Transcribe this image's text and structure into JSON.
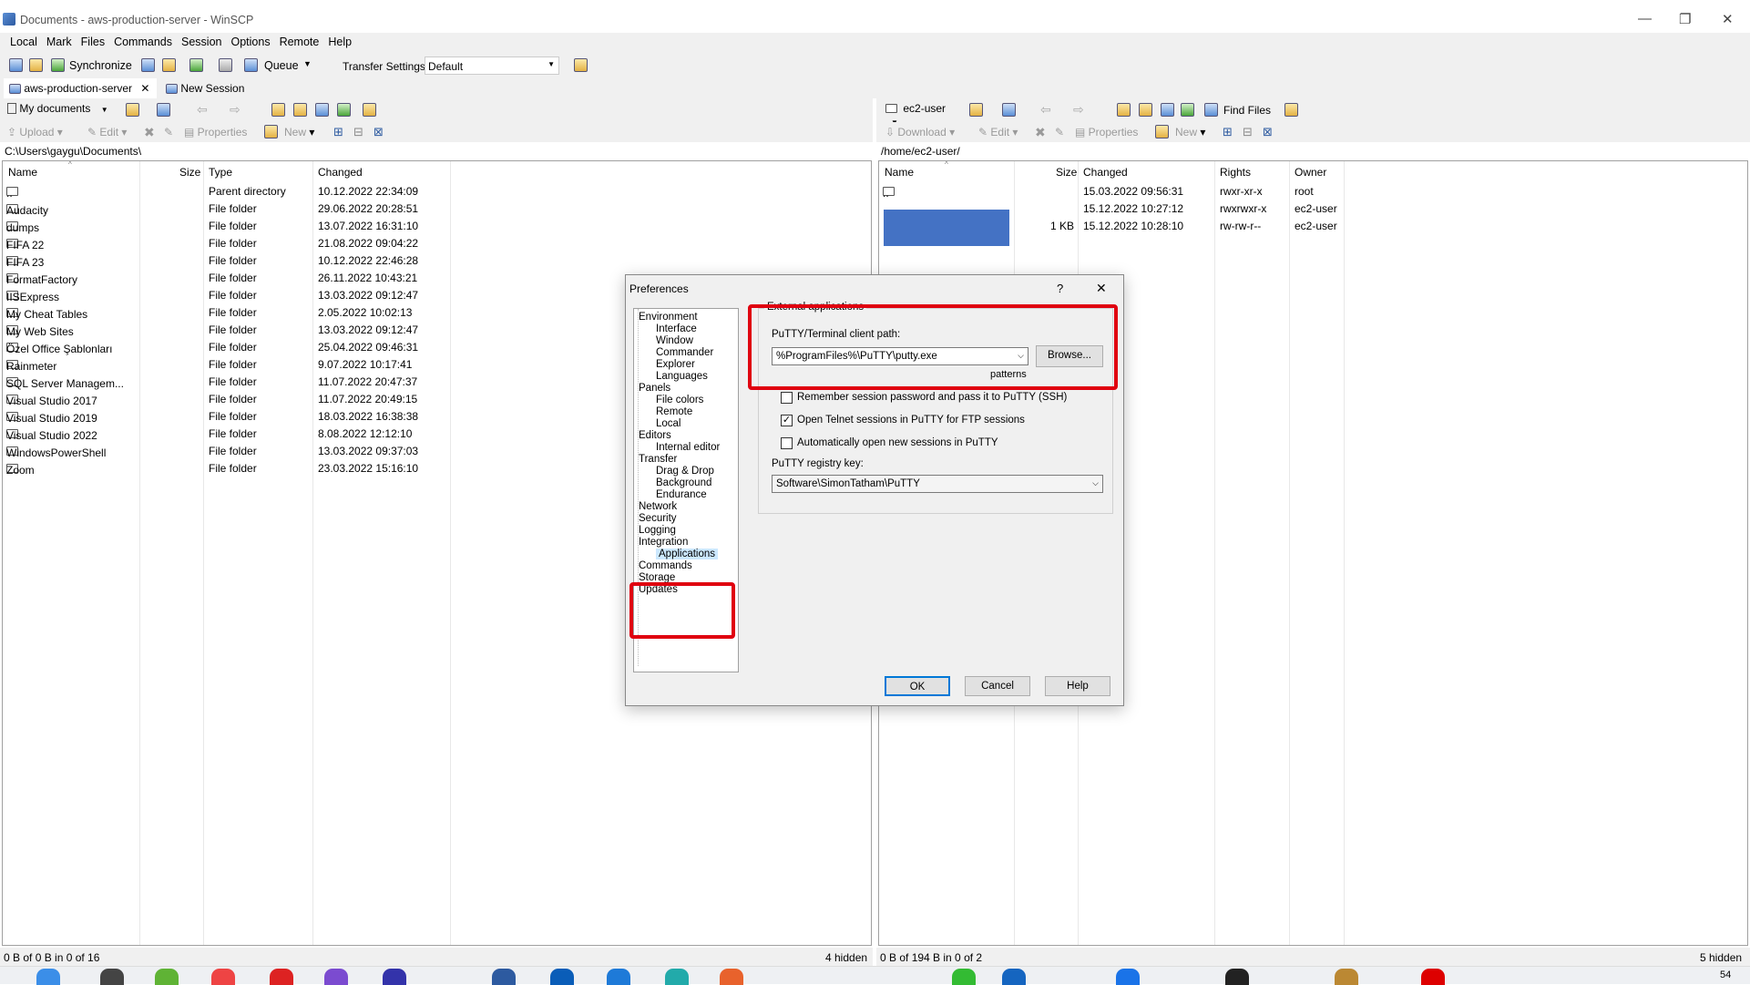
{
  "window": {
    "title": "Documents - aws-production-server - WinSCP"
  },
  "menu": [
    "Local",
    "Mark",
    "Files",
    "Commands",
    "Session",
    "Options",
    "Remote",
    "Help"
  ],
  "toolbar": {
    "synchronize": "Synchronize",
    "queue": "Queue",
    "transfer_settings_label": "Transfer Settings",
    "transfer_settings_value": "Default"
  },
  "tabs": {
    "session": "aws-production-server",
    "new_session": "New Session"
  },
  "local": {
    "location": "My documents",
    "commands": {
      "upload": "Upload",
      "edit": "Edit",
      "properties": "Properties",
      "new": "New"
    },
    "path": "C:\\Users\\gaygu\\Documents\\",
    "columns": [
      "Name",
      "Size",
      "Type",
      "Changed"
    ],
    "rows": [
      {
        "name": "..",
        "size": "",
        "type": "Parent directory",
        "changed": "10.12.2022  22:34:09"
      },
      {
        "name": "Audacity",
        "size": "",
        "type": "File folder",
        "changed": "29.06.2022  20:28:51"
      },
      {
        "name": "dumps",
        "size": "",
        "type": "File folder",
        "changed": "13.07.2022  16:31:10"
      },
      {
        "name": "FIFA 22",
        "size": "",
        "type": "File folder",
        "changed": "21.08.2022  09:04:22"
      },
      {
        "name": "FIFA 23",
        "size": "",
        "type": "File folder",
        "changed": "10.12.2022  22:46:28"
      },
      {
        "name": "FormatFactory",
        "size": "",
        "type": "File folder",
        "changed": "26.11.2022  10:43:21"
      },
      {
        "name": "IISExpress",
        "size": "",
        "type": "File folder",
        "changed": "13.03.2022  09:12:47"
      },
      {
        "name": "My Cheat Tables",
        "size": "",
        "type": "File folder",
        "changed": "2.05.2022  10:02:13"
      },
      {
        "name": "My Web Sites",
        "size": "",
        "type": "File folder",
        "changed": "13.03.2022  09:12:47"
      },
      {
        "name": "Özel Office Şablonları",
        "size": "",
        "type": "File folder",
        "changed": "25.04.2022  09:46:31"
      },
      {
        "name": "Rainmeter",
        "size": "",
        "type": "File folder",
        "changed": "9.07.2022  10:17:41"
      },
      {
        "name": "SQL Server Managem...",
        "size": "",
        "type": "File folder",
        "changed": "11.07.2022  20:47:37"
      },
      {
        "name": "Visual Studio 2017",
        "size": "",
        "type": "File folder",
        "changed": "11.07.2022  20:49:15"
      },
      {
        "name": "Visual Studio 2019",
        "size": "",
        "type": "File folder",
        "changed": "18.03.2022  16:38:38"
      },
      {
        "name": "Visual Studio 2022",
        "size": "",
        "type": "File folder",
        "changed": "8.08.2022  12:12:10"
      },
      {
        "name": "WindowsPowerShell",
        "size": "",
        "type": "File folder",
        "changed": "13.03.2022  09:37:03"
      },
      {
        "name": "Zoom",
        "size": "",
        "type": "File folder",
        "changed": "23.03.2022  15:16:10"
      }
    ],
    "status_left": "0 B of 0 B in 0 of 16",
    "status_right": "4 hidden"
  },
  "remote": {
    "location": "ec2-user",
    "find_files": "Find Files",
    "commands": {
      "download": "Download",
      "edit": "Edit",
      "properties": "Properties",
      "new": "New"
    },
    "path": "/home/ec2-user/",
    "columns": [
      "Name",
      "Size",
      "Changed",
      "Rights",
      "Owner"
    ],
    "rows": [
      {
        "name": "..",
        "size": "",
        "changed": "15.03.2022 09:56:31",
        "rights": "rwxr-xr-x",
        "owner": "root"
      },
      {
        "name": "",
        "size": "",
        "changed": "15.12.2022 10:27:12",
        "rights": "rwxrwxr-x",
        "owner": "ec2-user"
      },
      {
        "name": "",
        "size": "1 KB",
        "changed": "15.12.2022 10:28:10",
        "rights": "rw-rw-r--",
        "owner": "ec2-user"
      }
    ],
    "status_left": "0 B of 194 B in 0 of 2",
    "status_right": "5 hidden"
  },
  "dialog": {
    "title": "Preferences",
    "help_glyph": "?",
    "close_glyph": "✕",
    "tree": [
      {
        "label": "Environment",
        "level": 0
      },
      {
        "label": "Interface",
        "level": 1
      },
      {
        "label": "Window",
        "level": 1
      },
      {
        "label": "Commander",
        "level": 1
      },
      {
        "label": "Explorer",
        "level": 1
      },
      {
        "label": "Languages",
        "level": 1
      },
      {
        "label": "Panels",
        "level": 0
      },
      {
        "label": "File colors",
        "level": 1
      },
      {
        "label": "Remote",
        "level": 1
      },
      {
        "label": "Local",
        "level": 1
      },
      {
        "label": "Editors",
        "level": 0
      },
      {
        "label": "Internal editor",
        "level": 1
      },
      {
        "label": "Transfer",
        "level": 0
      },
      {
        "label": "Drag & Drop",
        "level": 1
      },
      {
        "label": "Background",
        "level": 1
      },
      {
        "label": "Endurance",
        "level": 1
      },
      {
        "label": "Network",
        "level": 0
      },
      {
        "label": "Security",
        "level": 0
      },
      {
        "label": "Logging",
        "level": 0
      },
      {
        "label": "Integration",
        "level": 0
      },
      {
        "label": "Applications",
        "level": 1,
        "selected": true
      },
      {
        "label": "Commands",
        "level": 0
      },
      {
        "label": "Storage",
        "level": 0
      },
      {
        "label": "Updates",
        "level": 0
      }
    ],
    "group_title": "External applications",
    "putty_path_label": "PuTTY/Terminal client path:",
    "putty_path_value": "%ProgramFiles%\\PuTTY\\putty.exe",
    "browse": "Browse...",
    "patterns": "patterns",
    "checkboxes": [
      {
        "label": "Remember session password and pass it to PuTTY (SSH)",
        "checked": false
      },
      {
        "label": "Open Telnet sessions in PuTTY for FTP sessions",
        "checked": true
      },
      {
        "label": "Automatically open new sessions in PuTTY",
        "checked": false
      }
    ],
    "registry_label": "PuTTY registry key:",
    "registry_value": "Software\\SimonTatham\\PuTTY",
    "ok": "OK",
    "cancel": "Cancel",
    "help": "Help"
  },
  "colors": {
    "highlight_red": "#e0000f",
    "selection_blue": "#4472c4",
    "tree_selected": "#cce8ff"
  },
  "taskbar_clock_fragment": "54"
}
